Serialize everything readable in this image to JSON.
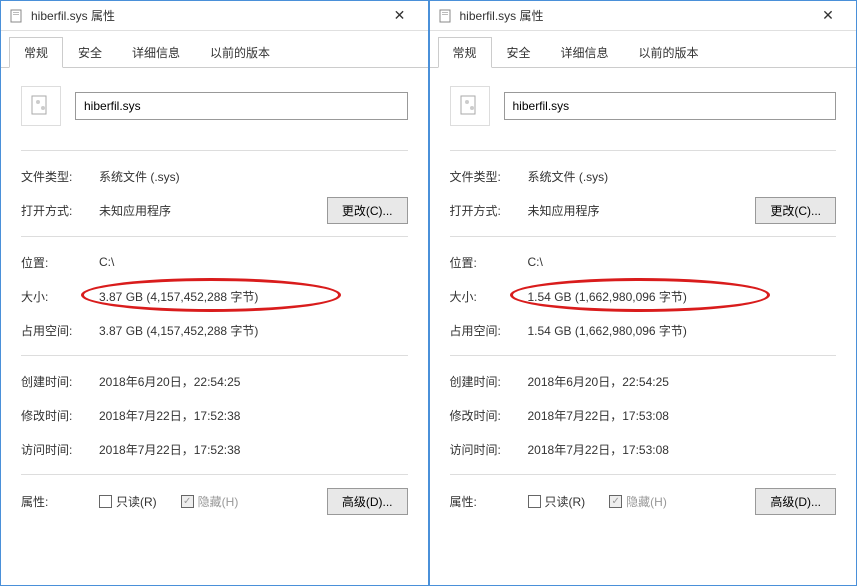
{
  "dialogs": [
    {
      "title": "hiberfil.sys 属性",
      "tabs": {
        "general": "常规",
        "security": "安全",
        "details": "详细信息",
        "previous": "以前的版本"
      },
      "filename": "hiberfil.sys",
      "labels": {
        "filetype": "文件类型:",
        "openwith": "打开方式:",
        "location": "位置:",
        "size": "大小:",
        "diskspace": "占用空间:",
        "created": "创建时间:",
        "modified": "修改时间:",
        "accessed": "访问时间:",
        "attributes": "属性:"
      },
      "values": {
        "filetype": "系统文件 (.sys)",
        "openwith": "未知应用程序",
        "location": "C:\\",
        "size": "3.87 GB (4,157,452,288 字节)",
        "diskspace": "3.87 GB (4,157,452,288 字节)",
        "created": "2018年6月20日，22:54:25",
        "modified": "2018年7月22日，17:52:38",
        "accessed": "2018年7月22日，17:52:38"
      },
      "buttons": {
        "change": "更改(C)...",
        "advanced": "高级(D)..."
      },
      "checkboxes": {
        "readonly": "只读(R)",
        "hidden": "隐藏(H)"
      }
    },
    {
      "title": "hiberfil.sys 属性",
      "tabs": {
        "general": "常规",
        "security": "安全",
        "details": "详细信息",
        "previous": "以前的版本"
      },
      "filename": "hiberfil.sys",
      "labels": {
        "filetype": "文件类型:",
        "openwith": "打开方式:",
        "location": "位置:",
        "size": "大小:",
        "diskspace": "占用空间:",
        "created": "创建时间:",
        "modified": "修改时间:",
        "accessed": "访问时间:",
        "attributes": "属性:"
      },
      "values": {
        "filetype": "系统文件 (.sys)",
        "openwith": "未知应用程序",
        "location": "C:\\",
        "size": "1.54 GB (1,662,980,096 字节)",
        "diskspace": "1.54 GB (1,662,980,096 字节)",
        "created": "2018年6月20日，22:54:25",
        "modified": "2018年7月22日，17:53:08",
        "accessed": "2018年7月22日，17:53:08"
      },
      "buttons": {
        "change": "更改(C)...",
        "advanced": "高级(D)..."
      },
      "checkboxes": {
        "readonly": "只读(R)",
        "hidden": "隐藏(H)"
      }
    }
  ]
}
